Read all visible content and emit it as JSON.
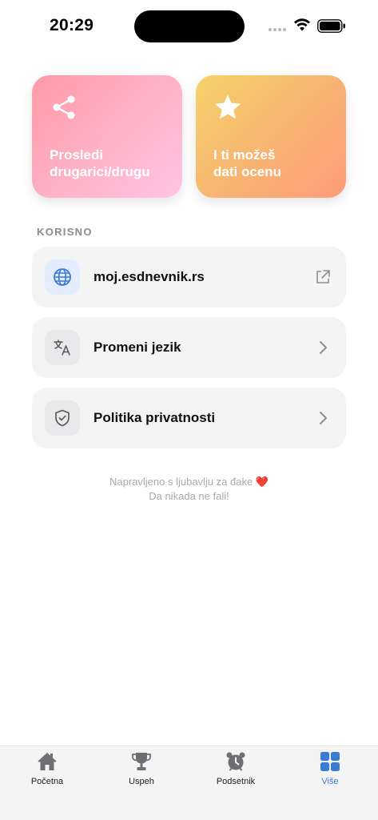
{
  "status_bar": {
    "time": "20:29"
  },
  "cards": {
    "share": {
      "line1": "Prosledi",
      "line2": "drugarici/drugu",
      "icon": "share-icon"
    },
    "rate": {
      "line1": "I ti možeš",
      "line2": "dati ocenu",
      "icon": "star-icon"
    }
  },
  "section": {
    "title": "KORISNO"
  },
  "rows": {
    "website": {
      "label": "moj.esdnevnik.rs",
      "icon": "globe-icon",
      "trailing": "external-link-icon"
    },
    "language": {
      "label": "Promeni jezik",
      "icon": "translate-icon",
      "trailing": "chevron-right-icon"
    },
    "privacy": {
      "label": "Politika privatnosti",
      "icon": "shield-check-icon",
      "trailing": "chevron-right-icon"
    }
  },
  "footer": {
    "line1": "Napravljeno s ljubavlju za đake",
    "heart": "❤️",
    "line2": "Da nikada ne fali!"
  },
  "tabbar": {
    "home": "Početna",
    "success": "Uspeh",
    "reminder": "Podsetnik",
    "more": "Više",
    "active": "more"
  },
  "colors": {
    "accent": "#3a7bd5",
    "share_gradient": [
      "#ff9aa6",
      "#ffc4e6"
    ],
    "rate_gradient": [
      "#f6d36a",
      "#ff9c7a"
    ]
  }
}
